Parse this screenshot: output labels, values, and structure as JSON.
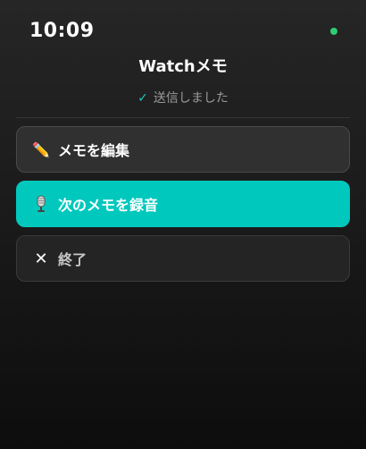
{
  "status_bar": {
    "time": "10:09",
    "indicator_color": "#2ecc71"
  },
  "header": {
    "title": "Watchメモ",
    "status_text": "送信しました",
    "status_icon": "check-icon"
  },
  "actions": {
    "edit": {
      "label": "メモを編集",
      "icon": "pencil-icon"
    },
    "record_next": {
      "label": "次のメモを録音",
      "icon": "microphone-icon"
    },
    "exit": {
      "label": "終了",
      "icon": "close-icon"
    }
  },
  "colors": {
    "accent": "#00c8bd",
    "check": "#1ec8b8"
  }
}
